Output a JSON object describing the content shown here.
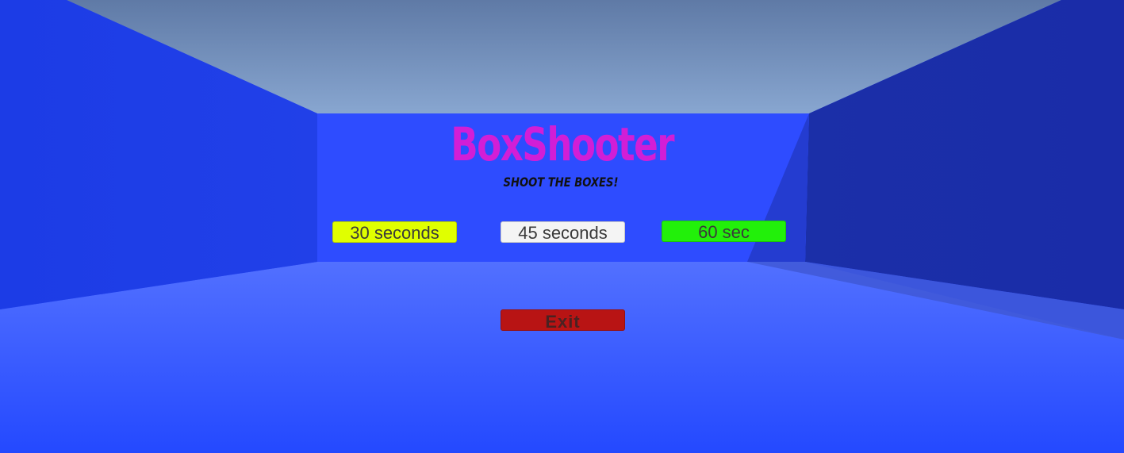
{
  "game": {
    "title": "BoxShooter",
    "title_color": "#d21ed6",
    "subtitle": "SHOOT THE BOXES!",
    "subtitle_color": "#111111"
  },
  "menu": {
    "buttons": [
      {
        "label": "30 seconds",
        "color": "#e0ff00"
      },
      {
        "label": "45 seconds",
        "color": "#f4f4f4"
      },
      {
        "label": "60 sec",
        "color": "#22f00a"
      }
    ],
    "exit": {
      "label": "Exit",
      "color": "#b81414"
    }
  },
  "environment": {
    "ceiling_color": "#6f8cb8",
    "back_wall_color": "#2e4cff",
    "left_wall_color": "#1e3ee0",
    "right_wall_color": "#1a30b8",
    "floor_color": "#3a5cff"
  }
}
